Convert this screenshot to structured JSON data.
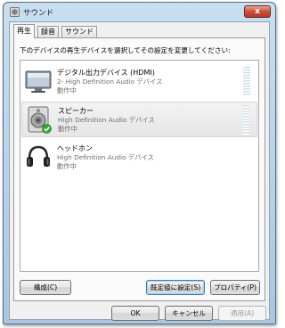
{
  "window": {
    "title": "サウンド",
    "close_label": "x"
  },
  "tabs": [
    {
      "label": "再生",
      "active": true
    },
    {
      "label": "録音",
      "active": false
    },
    {
      "label": "サウンド",
      "active": false
    }
  ],
  "instruction": "下のデバイスの再生デバイスを選択してその設定を変更してください:",
  "devices": [
    {
      "name": "デジタル出力デバイス (HDMI)",
      "description": "2- High Definition Audio デバイス",
      "status": "動作中",
      "icon": "monitor-icon",
      "selected": false,
      "default": false
    },
    {
      "name": "スピーカー",
      "description": "High Definition Audio デバイス",
      "status": "動作中",
      "icon": "speaker-icon",
      "selected": true,
      "default": true
    },
    {
      "name": "ヘッドホン",
      "description": "High Definition Audio デバイス",
      "status": "動作中",
      "icon": "headphones-icon",
      "selected": false,
      "default": false
    }
  ],
  "panel_buttons": {
    "configure": "構成(C)",
    "set_default": "既定値に設定(S)",
    "properties": "プロパティ(P)"
  },
  "dialog_buttons": {
    "ok": "OK",
    "cancel": "キャンセル",
    "apply": "適用(A)"
  },
  "colors": {
    "titlebar": "#b9d4ec",
    "close_button": "#c9503b",
    "default_check": "#3aa53a",
    "selection": "#e9e9e9"
  }
}
